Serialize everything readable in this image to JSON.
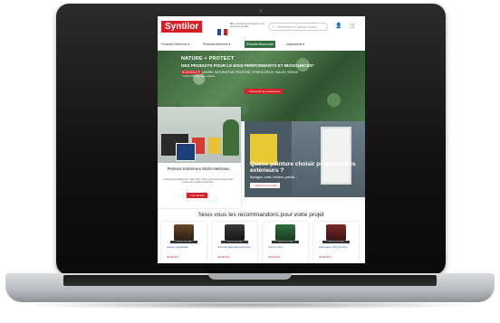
{
  "header": {
    "logo": "Syntilor",
    "tagline": "Bien entretenir avec Syntilor, c'est durable et durable",
    "search_placeholder": "Rechercher un produit, conseil...",
    "account_icon": "user-icon",
    "cart_icon": "cart-icon"
  },
  "nav": {
    "items": [
      {
        "label": "Produits Extérieurs ▾"
      },
      {
        "label": "Produits Intérieurs ▾"
      },
      {
        "label": "Produits Biosourcés"
      },
      {
        "label": "Inspirations ▾"
      }
    ]
  },
  "hero": {
    "title": "NATURE + PROTECT",
    "subtitle": "DES PRODUITS POUR LE BOIS PERFORMANTS ET BIOSOURCÉS*",
    "badge": "NOUVEAUTÉ",
    "line": "LASURE, SATURATEUR, PEINTURE, VITRIFICATEUR, HUILES, VERNIS",
    "note": "* Jusqu'à 97% d'origine végétale",
    "cta": "> Découvrir les nouveautés"
  },
  "promo1": {
    "title": "Peinture Extérieure Multi-matériaux",
    "desc": "Conçue pour protéger bois, métal, PVC et plus, cette peinture longue durée résiste aux conditions extérieures.",
    "cta": "> Je l'achète"
  },
  "promo2": {
    "title": "Quelle peinture choisir pour vos bois extérieurs ?",
    "desc": "Bardages, volets, fenêtres, portails...",
    "cta": "> Découvrir le guide"
  },
  "recommend": {
    "title": "Nous vous les recommandons pour votre projet",
    "products": [
      {
        "badge": "Testée en 1ère ligne",
        "name": "Lasure Imbattable",
        "stars": "★★★★★"
      },
      {
        "badge": "Testée en 1ère ligne",
        "name": "Peinture Bois Microporeuse",
        "stars": "★★★★★"
      },
      {
        "badge": "Testée en 1ère ligne",
        "name": "Vernis marin",
        "stars": "★★★★★"
      },
      {
        "badge": "Testée en 1ère ligne",
        "name": "Saturateur Ultra Protect",
        "stars": "★★★★★"
      }
    ]
  },
  "colors": {
    "brand": "#d41f26",
    "green": "#2f6f3f"
  }
}
